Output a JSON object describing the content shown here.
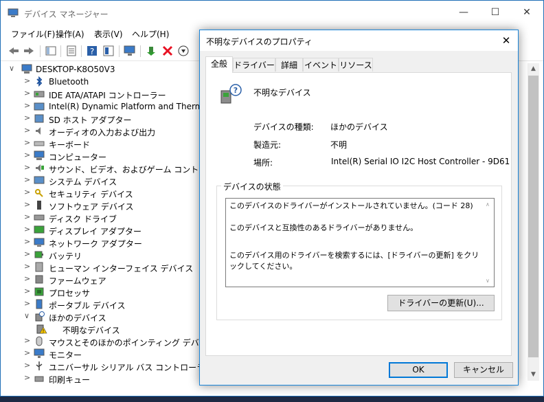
{
  "device_manager": {
    "title": "デバイス マネージャー",
    "menu": [
      "ファイル(F)",
      "操作(A)",
      "表示(V)",
      "ヘルプ(H)"
    ],
    "computer_name": "DESKTOP-K8O50V3",
    "tree": [
      {
        "label": "Bluetooth",
        "icon": "bluetooth-icon"
      },
      {
        "label": "IDE ATA/ATAPI コントローラー",
        "icon": "ide-controller-icon"
      },
      {
        "label": "Intel(R) Dynamic Platform and Thermal Fra",
        "icon": "intel-platform-icon"
      },
      {
        "label": "SD ホスト アダプター",
        "icon": "sd-host-icon"
      },
      {
        "label": "オーディオの入力および出力",
        "icon": "audio-icon"
      },
      {
        "label": "キーボード",
        "icon": "keyboard-icon"
      },
      {
        "label": "コンピューター",
        "icon": "computer-icon"
      },
      {
        "label": "サウンド、ビデオ、およびゲーム コントローラー",
        "icon": "sound-video-icon"
      },
      {
        "label": "システム デバイス",
        "icon": "system-devices-icon"
      },
      {
        "label": "セキュリティ デバイス",
        "icon": "security-device-icon"
      },
      {
        "label": "ソフトウェア デバイス",
        "icon": "software-device-icon"
      },
      {
        "label": "ディスク ドライブ",
        "icon": "disk-drive-icon"
      },
      {
        "label": "ディスプレイ アダプター",
        "icon": "display-adapter-icon"
      },
      {
        "label": "ネットワーク アダプター",
        "icon": "network-adapter-icon"
      },
      {
        "label": "バッテリ",
        "icon": "battery-icon"
      },
      {
        "label": "ヒューマン インターフェイス デバイス",
        "icon": "hid-icon"
      },
      {
        "label": "ファームウェア",
        "icon": "firmware-icon"
      },
      {
        "label": "プロセッサ",
        "icon": "processor-icon"
      },
      {
        "label": "ポータブル デバイス",
        "icon": "portable-device-icon"
      },
      {
        "label": "ほかのデバイス",
        "icon": "other-devices-icon"
      },
      {
        "label": "不明なデバイス",
        "icon": "unknown-device-warning-icon"
      },
      {
        "label": "マウスとそのほかのポインティング デバイス",
        "icon": "mouse-icon"
      },
      {
        "label": "モニター",
        "icon": "monitor-icon"
      },
      {
        "label": "ユニバーサル シリアル バス コントローラー",
        "icon": "usb-icon"
      },
      {
        "label": "印刷キュー",
        "icon": "print-queue-icon"
      }
    ]
  },
  "dialog": {
    "title": "不明なデバイスのプロパティ",
    "tabs": [
      "全般",
      "ドライバー",
      "詳細",
      "イベント",
      "リソース"
    ],
    "active_tab": "全般",
    "device_name": "不明なデバイス",
    "properties": {
      "type_label": "デバイスの種類:",
      "type_value": "ほかのデバイス",
      "manufacturer_label": "製造元:",
      "manufacturer_value": "不明",
      "location_label": "場所:",
      "location_value": "Intel(R) Serial IO I2C Host Controller - 9D61"
    },
    "status_group_label": "デバイスの状態",
    "status_text": {
      "line1": "このデバイスのドライバーがインストールされていません。(コード 28)",
      "line2": "このデバイスと互換性のあるドライバーがありません。",
      "line3": "このデバイス用のドライバーを検索するには、[ドライバーの更新] をクリックしてください。"
    },
    "update_driver_button": "ドライバーの更新(U)...",
    "ok_button": "OK",
    "cancel_button": "キャンセル"
  },
  "colors": {
    "accent": "#0078d7",
    "error_red": "#e81123",
    "warning_yellow": "#f5c400"
  }
}
